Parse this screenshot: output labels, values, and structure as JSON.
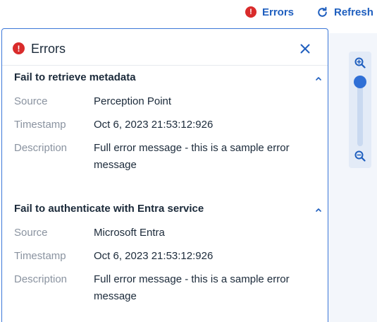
{
  "toolbar": {
    "errors_label": "Errors",
    "refresh_label": "Refresh",
    "error_icon_glyph": "!"
  },
  "panel": {
    "title": "Errors",
    "errors": [
      {
        "title": "Fail to retrieve metadata",
        "source_label": "Source",
        "source": "Perception Point",
        "timestamp_label": "Timestamp",
        "timestamp": "Oct 6, 2023 21:53:12:926",
        "description_label": "Description",
        "description": "Full error message - this is a sample error message"
      },
      {
        "title": "Fail to authenticate with Entra service",
        "source_label": "Source",
        "source": "Microsoft Entra",
        "timestamp_label": "Timestamp",
        "timestamp": "Oct 6, 2023 21:53:12:926",
        "description_label": "Description",
        "description": "Full error message - this is a sample error message"
      }
    ]
  },
  "colors": {
    "accent": "#1f5fbf",
    "error": "#d92b2b",
    "panel_border": "#3c78d8",
    "label_gray": "#8a93a0",
    "text_dark": "#1b2a3a",
    "canvas_bg": "#f3f6fb"
  },
  "icons": {
    "error": "error-circle-icon",
    "refresh": "refresh-icon",
    "close": "close-icon",
    "collapse": "chevron-up-icon",
    "zoom_in": "zoom-in-icon",
    "zoom_out": "zoom-out-icon"
  }
}
